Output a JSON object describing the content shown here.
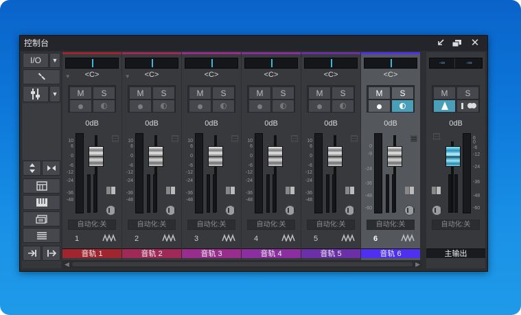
{
  "window": {
    "title": "控制台"
  },
  "sidebar": {
    "io_label": "I/O"
  },
  "channels": [
    {
      "number": "1",
      "name": "音轨 1",
      "color": "#a1252e",
      "pan": "<C>",
      "volume": "0dB",
      "mute": "M",
      "solo": "S",
      "automation": "自动化:关",
      "fader_level_db": 0
    },
    {
      "number": "2",
      "name": "音轨 2",
      "color": "#9f2a57",
      "pan": "<C>",
      "volume": "0dB",
      "mute": "M",
      "solo": "S",
      "automation": "自动化:关",
      "fader_level_db": 0
    },
    {
      "number": "3",
      "name": "音轨 3",
      "color": "#992d8d",
      "pan": "<C>",
      "volume": "0dB",
      "mute": "M",
      "solo": "S",
      "automation": "自动化:关",
      "fader_level_db": 0
    },
    {
      "number": "4",
      "name": "音轨 4",
      "color": "#8a2ea0",
      "pan": "<C>",
      "volume": "0dB",
      "mute": "M",
      "solo": "S",
      "automation": "自动化:关",
      "fader_level_db": 0
    },
    {
      "number": "5",
      "name": "音轨 5",
      "color": "#6b2fa8",
      "pan": "<C>",
      "volume": "0dB",
      "mute": "M",
      "solo": "S",
      "automation": "自动化:关",
      "fader_level_db": 0
    },
    {
      "number": "6",
      "name": "音轨 6",
      "color": "#4f2ff0",
      "pan": "<C>",
      "volume": "0dB",
      "mute": "M",
      "solo": "S",
      "automation": "自动化:关",
      "fader_level_db": 0,
      "selected": true
    }
  ],
  "scale_labels": [
    "10",
    "6",
    "0",
    "-6",
    "-12",
    "-24",
    "-36",
    "-48"
  ],
  "selected_scale_labels": [
    "0",
    "-9",
    "-24",
    "-36",
    "-48",
    "-60"
  ],
  "master": {
    "name": "主输出",
    "pan_left": "-∞",
    "pan_right": "-∞",
    "mute": "M",
    "solo": "S",
    "volume": "0dB",
    "automation": "自动化:关",
    "scale_labels": [
      "6",
      "0",
      "-6",
      "-12",
      "-24",
      "-36",
      "-48",
      "-60"
    ]
  },
  "colors": {
    "accent_selected": "#4f2ff0",
    "meter_cyan": "#3db9d8"
  }
}
